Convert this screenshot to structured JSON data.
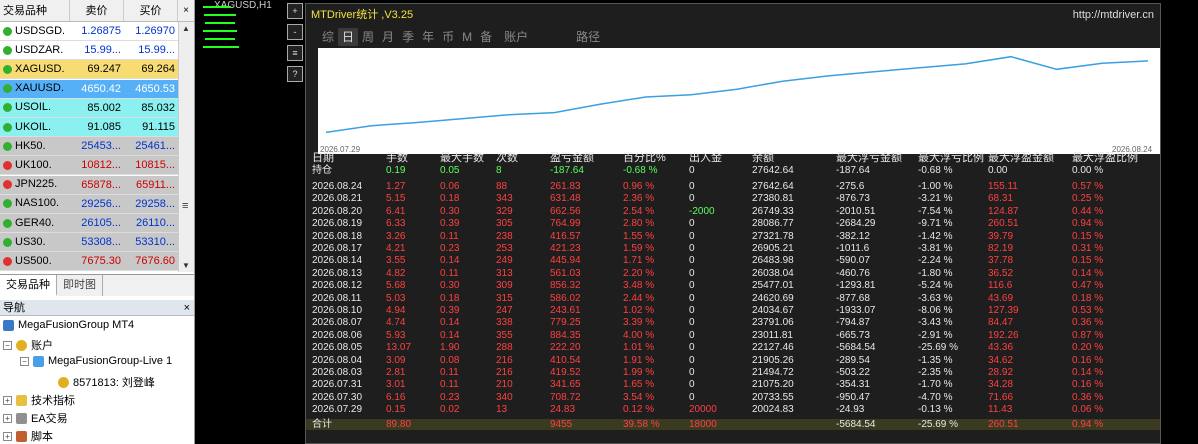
{
  "colors": {
    "up_bg": "#8af0f0",
    "yellow_bg": "#f7dc74",
    "blue_bg": "#55b0f7",
    "gray_bg": "#c8c8c8",
    "red": "#ff4040",
    "green": "#5bff5b",
    "white": "#e8e8e8"
  },
  "market_watch": {
    "headers": [
      "交易品种",
      "卖价",
      "买价"
    ],
    "rows": [
      {
        "symbol": "USDSGD.",
        "bid": "1.26875",
        "ask": "1.26970",
        "bg": "#ffffff",
        "color": "#0033cc"
      },
      {
        "symbol": "USDZAR.",
        "bid": "15.99...",
        "ask": "15.99...",
        "bg": "#ffffff",
        "color": "#0033cc"
      },
      {
        "symbol": "XAGUSD.",
        "bid": "69.247",
        "ask": "69.264",
        "bg": "#f7dc74",
        "color": "#000000"
      },
      {
        "symbol": "XAUUSD.",
        "bid": "4650.42",
        "ask": "4650.53",
        "bg": "#55b0f7",
        "color": "#ffffff"
      },
      {
        "symbol": "USOIL.",
        "bid": "85.002",
        "ask": "85.032",
        "bg": "#8af0f0",
        "color": "#000000"
      },
      {
        "symbol": "UKOIL.",
        "bid": "91.085",
        "ask": "91.115",
        "bg": "#8af0f0",
        "color": "#000000"
      },
      {
        "symbol": "HK50.",
        "bid": "25453...",
        "ask": "25461...",
        "bg": "#c8c8c8",
        "color": "#0033cc"
      },
      {
        "symbol": "UK100.",
        "bid": "10812...",
        "ask": "10815...",
        "bg": "#c8c8c8",
        "color": "#cc0000"
      },
      {
        "symbol": "JPN225.",
        "bid": "65878...",
        "ask": "65911...",
        "bg": "#c8c8c8",
        "color": "#cc0000"
      },
      {
        "symbol": "NAS100.",
        "bid": "29256...",
        "ask": "29258...",
        "bg": "#c8c8c8",
        "color": "#0033cc"
      },
      {
        "symbol": "GER40.",
        "bid": "26105...",
        "ask": "26110...",
        "bg": "#c8c8c8",
        "color": "#0033cc"
      },
      {
        "symbol": "US30.",
        "bid": "53308...",
        "ask": "53310...",
        "bg": "#c8c8c8",
        "color": "#0033cc"
      },
      {
        "symbol": "US500.",
        "bid": "7675.30",
        "ask": "7676.60",
        "bg": "#c8c8c8",
        "color": "#cc0000"
      }
    ],
    "tabs": [
      "交易品种",
      "即时图"
    ],
    "scroll_mid": "≡"
  },
  "navigator": {
    "title": "导航",
    "close": "×",
    "items": [
      "MegaFusionGroup MT4",
      "账户",
      "MegaFusionGroup-Live 1",
      "8571813: 刘登峰",
      "技术指标",
      "EA交易",
      "脚本"
    ]
  },
  "toolbar": {
    "buttons": [
      "+",
      "-",
      "≡",
      "?"
    ]
  },
  "chart_top_label": "XAGUSD,H1",
  "panel": {
    "title": "MTDriver统计 ,V3.25",
    "url": "http://mtdriver.cn",
    "tabs": [
      "综",
      "日",
      "周",
      "月",
      "季",
      "年",
      "币",
      "M",
      "备",
      "账户",
      "路径"
    ],
    "chart_start": "2026.07.29",
    "chart_end": "2026.08.24",
    "headers": [
      "日期",
      "手数",
      "最大手数",
      "次数",
      "盈亏金额",
      "百分比%",
      "出入金",
      "余额",
      "最大浮亏金额",
      "最大浮亏比例",
      "最大浮盈金额",
      "最大浮盈比例"
    ],
    "hold_row": [
      "持仓",
      "0.19",
      "0.05",
      "8",
      "-187.64",
      "-0.68 %",
      "0",
      "27642.64",
      "-187.64",
      "-0.68 %",
      "0.00",
      "0.00 %"
    ],
    "rows": [
      [
        "2026.08.24",
        "1.27",
        "0.06",
        "88",
        "261.83",
        "0.96 %",
        "0",
        "27642.64",
        "-275.6",
        "-1.00 %",
        "155.11",
        "0.57 %"
      ],
      [
        "2026.08.21",
        "5.15",
        "0.18",
        "343",
        "631.48",
        "2.36 %",
        "0",
        "27380.81",
        "-876.73",
        "-3.21 %",
        "68.31",
        "0.25 %"
      ],
      [
        "2026.08.20",
        "6.41",
        "0.30",
        "329",
        "662.56",
        "2.54 %",
        "-2000",
        "26749.33",
        "-2010.51",
        "-7.54 %",
        "124.87",
        "0.44 %"
      ],
      [
        "2026.08.19",
        "6.33",
        "0.39",
        "305",
        "764.99",
        "2.80 %",
        "0",
        "28086.77",
        "-2684.29",
        "-9.71 %",
        "260.51",
        "0.94 %"
      ],
      [
        "2026.08.18",
        "3.26",
        "0.11",
        "238",
        "416.57",
        "1.55 %",
        "0",
        "27321.78",
        "-382.12",
        "-1.42 %",
        "39.79",
        "0.15 %"
      ],
      [
        "2026.08.17",
        "4.21",
        "0.23",
        "253",
        "421.23",
        "1.59 %",
        "0",
        "26905.21",
        "-1011.6",
        "-3.81 %",
        "82.19",
        "0.31 %"
      ],
      [
        "2026.08.14",
        "3.55",
        "0.14",
        "249",
        "445.94",
        "1.71 %",
        "0",
        "26483.98",
        "-590.07",
        "-2.24 %",
        "37.78",
        "0.15 %"
      ],
      [
        "2026.08.13",
        "4.82",
        "0.11",
        "313",
        "561.03",
        "2.20 %",
        "0",
        "26038.04",
        "-460.76",
        "-1.80 %",
        "36.52",
        "0.14 %"
      ],
      [
        "2026.08.12",
        "5.68",
        "0.30",
        "309",
        "856.32",
        "3.48 %",
        "0",
        "25477.01",
        "-1293.81",
        "-5.24 %",
        "116.6",
        "0.47 %"
      ],
      [
        "2026.08.11",
        "5.03",
        "0.18",
        "315",
        "586.02",
        "2.44 %",
        "0",
        "24620.69",
        "-877.68",
        "-3.63 %",
        "43.69",
        "0.18 %"
      ],
      [
        "2026.08.10",
        "4.94",
        "0.39",
        "247",
        "243.61",
        "1.02 %",
        "0",
        "24034.67",
        "-1933.07",
        "-8.06 %",
        "127.39",
        "0.53 %"
      ],
      [
        "2026.08.07",
        "4.74",
        "0.14",
        "338",
        "779.25",
        "3.39 %",
        "0",
        "23791.06",
        "-794.87",
        "-3.43 %",
        "84.47",
        "0.36 %"
      ],
      [
        "2026.08.06",
        "5.93",
        "0.14",
        "355",
        "884.35",
        "4.00 %",
        "0",
        "23011.81",
        "-665.73",
        "-2.91 %",
        "192.26",
        "0.87 %"
      ],
      [
        "2026.08.05",
        "13.07",
        "1.90",
        "288",
        "222.20",
        "1.01 %",
        "0",
        "22127.46",
        "-5684.54",
        "-25.69 %",
        "43.36",
        "0.20 %"
      ],
      [
        "2026.08.04",
        "3.09",
        "0.08",
        "216",
        "410.54",
        "1.91 %",
        "0",
        "21905.26",
        "-289.54",
        "-1.35 %",
        "34.62",
        "0.16 %"
      ],
      [
        "2026.08.03",
        "2.81",
        "0.11",
        "216",
        "419.52",
        "1.99 %",
        "0",
        "21494.72",
        "-503.22",
        "-2.35 %",
        "28.92",
        "0.14 %"
      ],
      [
        "2026.07.31",
        "3.01",
        "0.11",
        "210",
        "341.65",
        "1.65 %",
        "0",
        "21075.20",
        "-354.31",
        "-1.70 %",
        "34.28",
        "0.16 %"
      ],
      [
        "2026.07.30",
        "6.16",
        "0.23",
        "340",
        "708.72",
        "3.54 %",
        "0",
        "20733.55",
        "-950.47",
        "-4.70 %",
        "71.66",
        "0.36 %"
      ],
      [
        "2026.07.29",
        "0.15",
        "0.02",
        "13",
        "24.83",
        "0.12 %",
        "20000",
        "20024.83",
        "-24.93",
        "-0.13 %",
        "11.43",
        "0.06 %"
      ]
    ],
    "total_row": [
      "合计",
      "89.80",
      "",
      "9455",
      "39.58 %",
      "18000",
      "",
      "-5684.54",
      "-25.69 %",
      "260.51",
      "0.94 %"
    ],
    "total_col_pnl": "",
    "balance_curve": [
      20024.83,
      20733.55,
      21075.2,
      21494.72,
      21905.26,
      22127.46,
      23011.81,
      23791.06,
      24034.67,
      24620.69,
      25477.01,
      26038.04,
      26483.98,
      26905.21,
      27321.78,
      28086.77,
      26749.33,
      27380.81,
      27642.64
    ]
  }
}
